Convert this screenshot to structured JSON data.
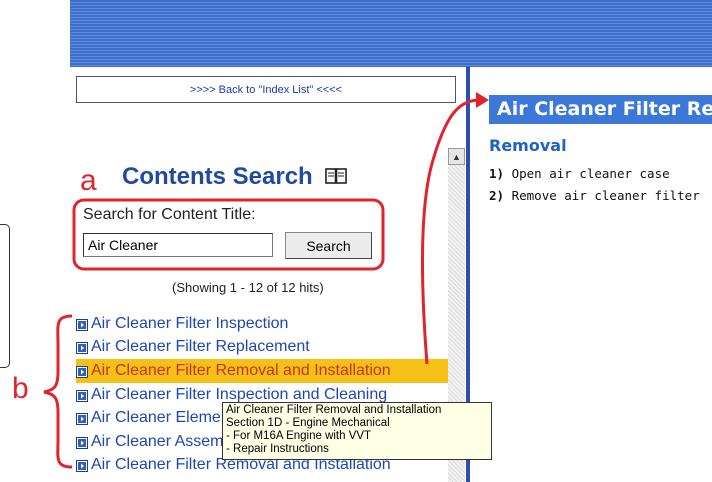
{
  "nav": {
    "back_label": ">>>> Back to \"Index List\" <<<<"
  },
  "search": {
    "title": "Contents Search",
    "label": "Search for Content Title:",
    "input_value": "Air Cleaner",
    "button_label": "Search",
    "hits_text": "(Showing 1 - 12 of 12 hits)"
  },
  "results": [
    {
      "label": "Air Cleaner Filter Inspection"
    },
    {
      "label": "Air Cleaner Filter Replacement"
    },
    {
      "label": "Air Cleaner Filter Removal and Installation"
    },
    {
      "label": "Air Cleaner Filter Inspection and Cleaning"
    },
    {
      "label": "Air Cleaner Element"
    },
    {
      "label": "Air Cleaner Assembly"
    },
    {
      "label": "Air Cleaner Filter Removal and Installation"
    }
  ],
  "tooltip": {
    "lines": [
      "Air Cleaner Filter Removal and Installation",
      "Section 1D - Engine Mechanical",
      "- For M16A Engine with VVT",
      "- Repair Instructions"
    ]
  },
  "content": {
    "heading": "Air Cleaner Filter Removal and Installation",
    "section": "Removal",
    "steps": [
      {
        "num": "1)",
        "text": "Open air cleaner case"
      },
      {
        "num": "2)",
        "text": "Remove air cleaner filter"
      }
    ]
  },
  "annotations": {
    "a": "a",
    "b": "b",
    "color": "#e0242f"
  },
  "colors": {
    "header": "#4a7bd4",
    "highlight": "#f5c018",
    "link": "#1c47b5",
    "accent": "#e0242f"
  }
}
